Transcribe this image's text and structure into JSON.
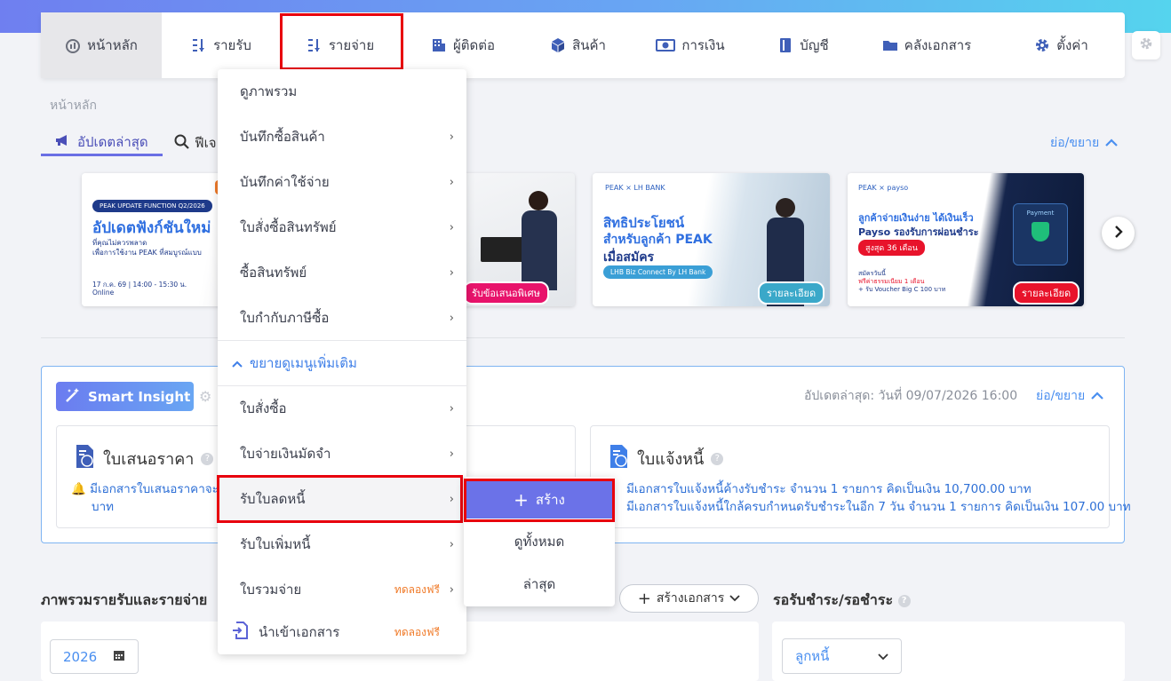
{
  "nav": {
    "items": [
      {
        "label": "หน้าหลัก",
        "icon": "dashboard-icon"
      },
      {
        "label": "รายรับ",
        "icon": "sort-list-icon"
      },
      {
        "label": "รายจ่าย",
        "icon": "sort-list-icon"
      },
      {
        "label": "ผู้ติดต่อ",
        "icon": "building-icon"
      },
      {
        "label": "สินค้า",
        "icon": "box-icon"
      },
      {
        "label": "การเงิน",
        "icon": "money-icon"
      },
      {
        "label": "บัญชี",
        "icon": "book-icon"
      },
      {
        "label": "คลังเอกสาร",
        "icon": "folder-icon"
      },
      {
        "label": "ตั้งค่า",
        "icon": "gear-icon"
      }
    ]
  },
  "breadcrumb": "หน้าหลัก",
  "tabs": {
    "updates": "อัปเดตล่าสุด",
    "features": "ฟีเจ"
  },
  "collapse_label": "ย่อ/ขยาย",
  "banners": {
    "b1": {
      "tag": "PEAK UPDATE FUNCTION Q2/2026",
      "title": "อัปเดตฟังก์ชันใหม่",
      "line1": "ที่คุณไม่ควรพลาด",
      "line2": "เพื่อการใช้งาน PEAK ที่สมบูรณ์แบบ",
      "date": "17 ก.ค. 69 | 14:00 - 15:30 น.",
      "mode": "Online"
    },
    "b2": {
      "cta": "รับข้อเสนอพิเศษ"
    },
    "b3": {
      "logo": "PEAK × LH BANK",
      "title1": "สิทธิประโยชน์",
      "title2": "สำหรับลูกค้า PEAK",
      "title3": "เมื่อสมัคร",
      "pill": "LHB Biz Connect By LH Bank",
      "cta": "รายละเอียด"
    },
    "b4": {
      "logo": "PEAK × payso",
      "title1": "ลูกค้าจ่ายเงินง่าย ได้เงินเร็ว",
      "title2": "Payso รองรับการผ่อนชำระ",
      "pill": "สูงสุด 36 เดือน",
      "note1": "สมัครวันนี้",
      "note2": "ฟรีค่าธรรมเนียม 1 เดือน",
      "note3": "+ รับ Voucher Big C 100 บาท",
      "cta": "รายละเอียด",
      "phone_label": "Payment"
    }
  },
  "insight": {
    "button": "Smart Insight",
    "updated": "อัปเดตล่าสุด: วันที่ 09/07/2026 16:00",
    "collapse": "ย่อ/ขยาย",
    "quote_card": {
      "title": "ใบเสนอราคา",
      "line1": "มีเอกสารใบเสนอราคาจะค",
      "line2": "บาท"
    },
    "invoice_card": {
      "title": "ใบแจ้งหนี้",
      "line1": "มีเอกสารใบแจ้งหนี้ค้างรับชำระ จำนวน 1 รายการ คิดเป็นเงิน 10,700.00 บาท",
      "line2": "มีเอกสารใบแจ้งหนี้ใกล้ครบกำหนดรับชำระในอีก 7 วัน จำนวน 1 รายการ คิดเป็นเงิน 107.00 บาท"
    }
  },
  "overview": {
    "title": "ภาพรวมรายรับและรายจ่าย",
    "create_doc": "สร้างเอกสาร",
    "year": "2026"
  },
  "pending": {
    "title": "รอรับชำระ/รอชำระ",
    "select": "ลูกหนี้"
  },
  "menu": {
    "items": [
      {
        "label": "ดูภาพรวม"
      },
      {
        "label": "บันทึกซื้อสินค้า"
      },
      {
        "label": "บันทึกค่าใช้จ่าย"
      },
      {
        "label": "ใบสั่งซื้อสินทรัพย์"
      },
      {
        "label": "ซื้อสินทรัพย์"
      },
      {
        "label": "ใบกำกับภาษีซื้อ"
      }
    ],
    "expand": "ขยายดูเมนูเพิ่มเติม",
    "more": [
      {
        "label": "ใบสั่งซื้อ"
      },
      {
        "label": "ใบจ่ายเงินมัดจำ"
      },
      {
        "label": "รับใบลดหนี้"
      },
      {
        "label": "รับใบเพิ่มหนี้"
      },
      {
        "label": "ใบรวมจ่าย",
        "badge": "ทดลองฟรี"
      },
      {
        "label": "นำเข้าเอกสาร",
        "badge": "ทดลองฟรี"
      }
    ]
  },
  "submenu": {
    "create": "สร้าง",
    "view_all": "ดูทั้งหมด",
    "latest": "ล่าสุด"
  },
  "colors": {
    "accent": "#6b72e8",
    "highlight": "#e8000d",
    "link": "#4a8ff0",
    "trial": "#f07b2a"
  }
}
